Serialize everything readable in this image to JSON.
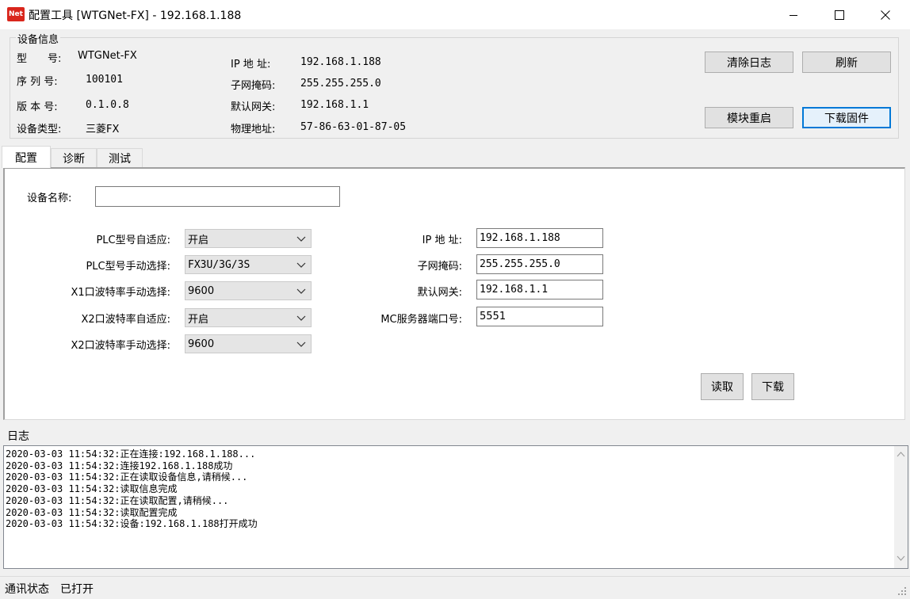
{
  "window": {
    "icon_label": "Net",
    "title": "配置工具 [WTGNet-FX] - 192.168.1.188"
  },
  "device_info": {
    "group_title": "设备信息",
    "model_label": "型　　号:",
    "model_value": "WTGNet-FX",
    "serial_label": "序 列 号:",
    "serial_value": "100101",
    "version_label": "版 本 号:",
    "version_value": "0.1.0.8",
    "type_label": "设备类型:",
    "type_value": "三菱FX",
    "ip_label": "IP 地 址:",
    "ip_value": "192.168.1.188",
    "mask_label": "子网掩码:",
    "mask_value": "255.255.255.0",
    "gateway_label": "默认网关:",
    "gateway_value": "192.168.1.1",
    "mac_label": "物理地址:",
    "mac_value": "57-86-63-01-87-05"
  },
  "buttons": {
    "clear_log": "清除日志",
    "refresh": "刷新",
    "reboot": "模块重启",
    "download_firmware": "下载固件",
    "read": "读取",
    "download": "下载"
  },
  "tabs": [
    {
      "label": "配置"
    },
    {
      "label": "诊断"
    },
    {
      "label": "测试"
    }
  ],
  "config": {
    "device_name_label": "设备名称:",
    "device_name_value": "",
    "plc_auto_label": "PLC型号自适应:",
    "plc_auto_value": "开启",
    "plc_manual_label": "PLC型号手动选择:",
    "plc_manual_value": "FX3U/3G/3S",
    "x1_baud_label": "X1口波特率手动选择:",
    "x1_baud_value": "9600",
    "x2_auto_label": "X2口波特率自适应:",
    "x2_auto_value": "开启",
    "x2_baud_label": "X2口波特率手动选择:",
    "x2_baud_value": "9600",
    "ip_label": "IP 地 址:",
    "ip_value": "192.168.1.188",
    "mask_label": "子网掩码:",
    "mask_value": "255.255.255.0",
    "gateway_label": "默认网关:",
    "gateway_value": "192.168.1.1",
    "mc_port_label": "MC服务器端口号:",
    "mc_port_value": "5551"
  },
  "log": {
    "title": "日志",
    "lines": [
      "2020-03-03 11:54:32:正在连接:192.168.1.188...",
      "2020-03-03 11:54:32:连接192.168.1.188成功",
      "2020-03-03 11:54:32:正在读取设备信息,请稍候...",
      "2020-03-03 11:54:32:读取信息完成",
      "2020-03-03 11:54:32:正在读取配置,请稍候...",
      "2020-03-03 11:54:32:读取配置完成",
      "2020-03-03 11:54:32:设备:192.168.1.188打开成功"
    ]
  },
  "status": {
    "label": "通讯状态",
    "value": "已打开"
  },
  "colors": {
    "accent": "#0078d7",
    "icon_red": "#d9261c"
  }
}
